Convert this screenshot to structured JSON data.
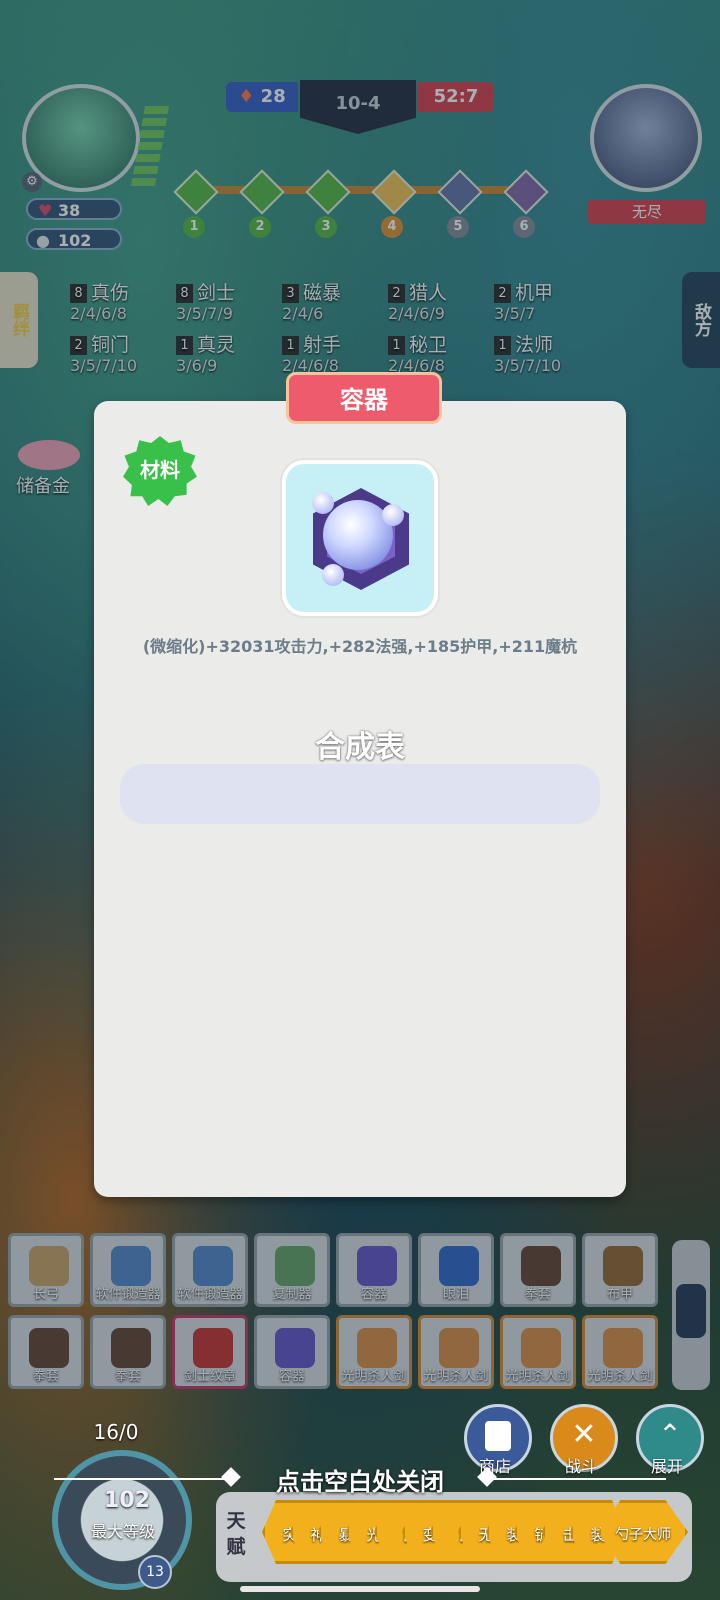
{
  "hud": {
    "health": "38",
    "gold_small": "102",
    "blue_score": "28",
    "round": "10-4",
    "red_timer": "52:7",
    "enemy_label": "无尽",
    "stage_nodes": [
      "1",
      "2",
      "3",
      "4",
      "5",
      "6"
    ]
  },
  "side_tabs": {
    "left": "羁绊",
    "right": "敌方"
  },
  "traits": [
    {
      "count": "8",
      "name": "真伤",
      "levels": "2/4/6/8"
    },
    {
      "count": "8",
      "name": "剑士",
      "levels": "3/5/7/9"
    },
    {
      "count": "3",
      "name": "磁暴",
      "levels": "2/4/6"
    },
    {
      "count": "2",
      "name": "猎人",
      "levels": "2/4/6/9"
    },
    {
      "count": "2",
      "name": "机甲",
      "levels": "3/5/7"
    },
    {
      "count": "2",
      "name": "铜门",
      "levels": "3/5/7/10"
    },
    {
      "count": "1",
      "name": "真灵",
      "levels": "3/6/9"
    },
    {
      "count": "1",
      "name": "射手",
      "levels": "2/4/6/8"
    },
    {
      "count": "1",
      "name": "秘卫",
      "levels": "2/4/6/8"
    },
    {
      "count": "1",
      "name": "法师",
      "levels": "3/5/7/10"
    }
  ],
  "piggy_label": "储备金",
  "modal": {
    "title": "容器",
    "tag": "材料",
    "item_icon": "orb-container-icon",
    "description": "(微缩化)+32031攻击力,+282法强,+185护甲,+211魔杭",
    "recipe_title": "合成表"
  },
  "inventory": [
    {
      "label": "长弓",
      "color": "#c9a36a"
    },
    {
      "label": "软件锻造器",
      "color": "#5a8ac8"
    },
    {
      "label": "软件锻造器",
      "color": "#5a8ac8"
    },
    {
      "label": "复制器",
      "color": "#6aa36a"
    },
    {
      "label": "容器",
      "color": "#6a5ac8"
    },
    {
      "label": "眼泪",
      "color": "#3a6ac8"
    },
    {
      "label": "拳套",
      "color": "#6a4a3a"
    },
    {
      "label": "布甲",
      "color": "#9a6a3a"
    },
    {
      "label": "拳套",
      "color": "#6a4a3a"
    },
    {
      "label": "拳套",
      "color": "#6a4a3a"
    },
    {
      "label": "剑士纹章",
      "color": "#c83a3a"
    },
    {
      "label": "容器",
      "color": "#6a5ac8"
    },
    {
      "label": "光明杀人剑",
      "color": "#d9904a"
    },
    {
      "label": "光明杀人剑",
      "color": "#d9904a"
    },
    {
      "label": "光明杀人剑",
      "color": "#d9904a"
    },
    {
      "label": "光明杀人剑",
      "color": "#d9904a"
    }
  ],
  "bottom": {
    "level_count": "16/0",
    "gold": "102",
    "max_level": "最大等级",
    "level": "13",
    "close_hint": "点击空白处关闭",
    "shop": "商店",
    "battle": "战斗",
    "expand": "展开",
    "talent_label": "天赋",
    "talents": [
      "突",
      "神",
      "暴",
      "光",
      "【",
      "变",
      "【",
      "无",
      "装",
      "铲",
      "击",
      "装",
      "勺子大师"
    ]
  }
}
